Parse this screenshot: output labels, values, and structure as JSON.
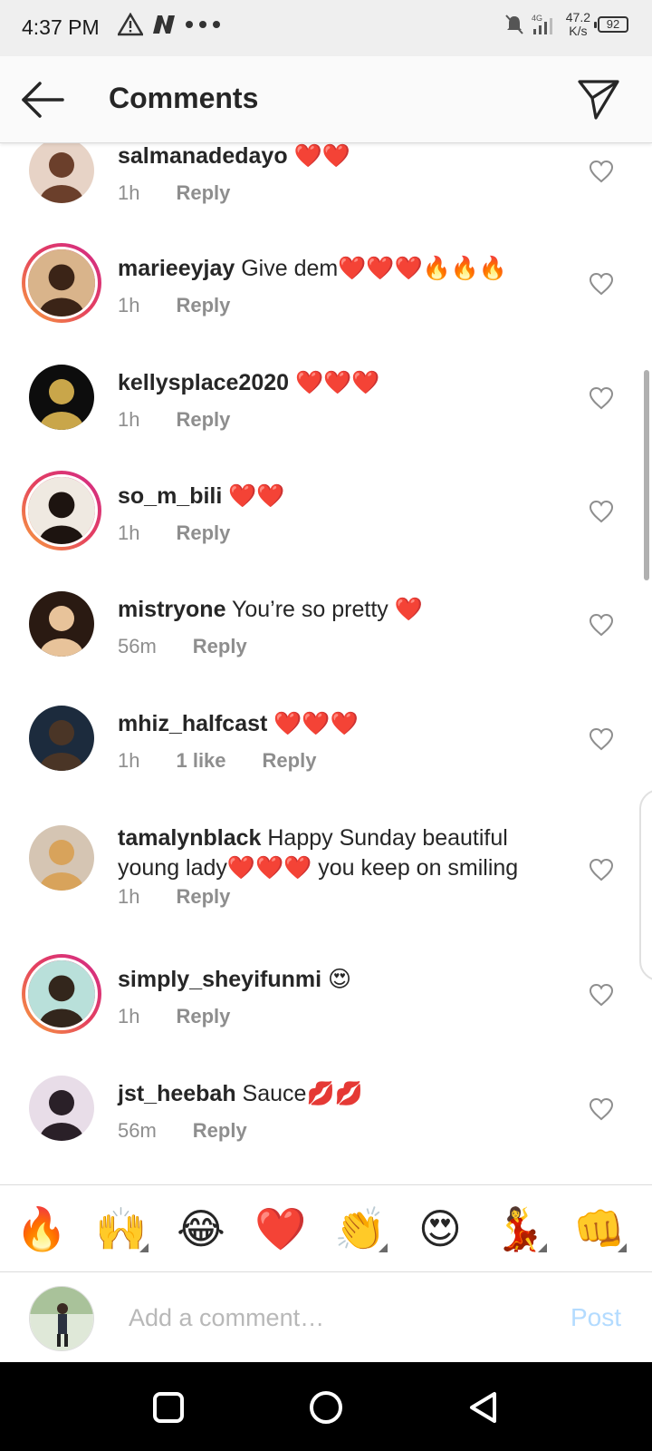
{
  "status": {
    "time": "4:37 PM",
    "net_speed_value": "47.2",
    "net_speed_unit": "K/s",
    "battery": "92",
    "signal_label": "4G"
  },
  "header": {
    "title": "Comments"
  },
  "comments": [
    {
      "username": "salmanadedayo",
      "text": " ❤️❤️",
      "time": "1h",
      "likes": "",
      "reply": "Reply",
      "ring": false
    },
    {
      "username": "marieeyjay",
      "text": " Give dem❤️❤️❤️🔥🔥🔥",
      "time": "1h",
      "likes": "",
      "reply": "Reply",
      "ring": true
    },
    {
      "username": "kellysplace2020",
      "text": " ❤️❤️❤️",
      "time": "1h",
      "likes": "",
      "reply": "Reply",
      "ring": false
    },
    {
      "username": "so_m_bili",
      "text": " ❤️❤️",
      "time": "1h",
      "likes": "",
      "reply": "Reply",
      "ring": true
    },
    {
      "username": "mistryone",
      "text": " You’re so pretty ❤️",
      "time": "56m",
      "likes": "",
      "reply": "Reply",
      "ring": false
    },
    {
      "username": "mhiz_halfcast",
      "text": " ❤️❤️❤️",
      "time": "1h",
      "likes": "1 like",
      "reply": "Reply",
      "ring": false
    },
    {
      "username": "tamalynblack",
      "text": " Happy Sunday beautiful young lady❤️❤️❤️ you keep on smiling",
      "time": "1h",
      "likes": "",
      "reply": "Reply",
      "ring": false
    },
    {
      "username": "simply_sheyifunmi",
      "text": " 😍",
      "time": "1h",
      "likes": "",
      "reply": "Reply",
      "ring": true
    },
    {
      "username": "jst_heebah",
      "text": " Sauce💋💋",
      "time": "56m",
      "likes": "",
      "reply": "Reply",
      "ring": false
    }
  ],
  "emoji_bar": [
    "🔥",
    "🙌",
    "😂",
    "❤️",
    "👏",
    "😍",
    "💃",
    "👊"
  ],
  "composer": {
    "placeholder": "Add a comment…",
    "post_label": "Post"
  },
  "colors": {
    "post_disabled": "#b3dbff",
    "meta_gray": "#8e8e8e",
    "ring_gradient_start": "#f9a33d",
    "ring_gradient_end": "#d22a89"
  }
}
